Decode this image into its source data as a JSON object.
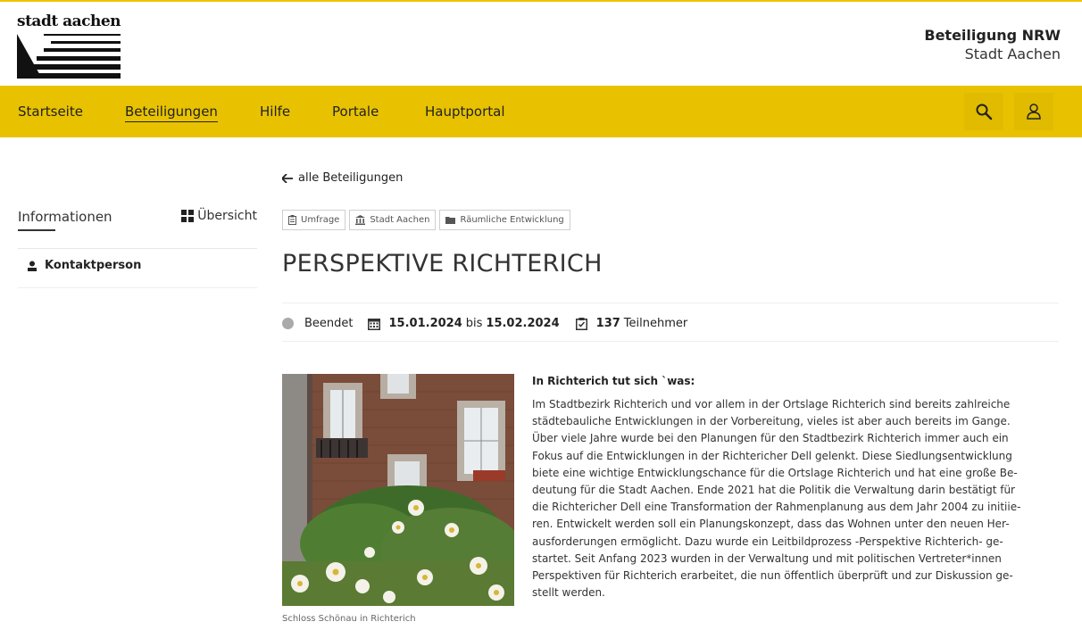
{
  "header": {
    "logo_text": "stadt aachen",
    "brand_title": "Beteiligung NRW",
    "brand_subtitle": "Stadt Aachen"
  },
  "nav": {
    "items": [
      {
        "label": "Startseite",
        "active": false
      },
      {
        "label": "Beteiligungen",
        "active": true
      },
      {
        "label": "Hilfe",
        "active": false
      },
      {
        "label": "Portale",
        "active": false
      },
      {
        "label": "Hauptportal",
        "active": false
      }
    ],
    "search_icon": "search-icon",
    "user_icon": "user-icon"
  },
  "sidebar": {
    "title": "Informationen",
    "overview_label": "Übersicht",
    "items": [
      {
        "label": "Kontaktperson",
        "icon": "person-icon"
      }
    ]
  },
  "main": {
    "back_label": "alle Beteiligungen",
    "tags": [
      {
        "label": "Umfrage",
        "icon": "clipboard-icon"
      },
      {
        "label": "Stadt Aachen",
        "icon": "building-icon"
      },
      {
        "label": "Räumliche Entwicklung",
        "icon": "folder-icon"
      }
    ],
    "title": "PERSPEKTIVE RICHTERICH",
    "meta": {
      "status": "Beendet",
      "start_date": "15.01.2024",
      "between": "bis",
      "end_date": "15.02.2024",
      "participants_count": "137",
      "participants_label": "Teilnehmer"
    },
    "image_caption": "Schloss Schönau in Richterich",
    "article_heading": "In Richterich tut sich `was:",
    "article_lines": [
      "Im Stadtbezirk Richterich und vor allem in der Ortslage Richterich sind bereits zahlreiche",
      "städtebauliche Entwicklungen in der Vorbereitung, vieles ist aber auch bereits im Gange.",
      "Über viele Jahre wurde bei den Planungen für den Stadtbezirk Richterich immer auch ein",
      "Fokus auf die Entwicklungen in der Richtericher Dell gelenkt. Diese Siedlungsentwicklung",
      "biete eine wichtige Entwicklungschance für die Ortslage Richterich und hat eine große Be-",
      "deutung für die Stadt Aachen. Ende 2021 hat die Politik die Verwaltung darin bestätigt für",
      "die Richtericher Dell eine Transformation der Rahmenplanung aus dem Jahr 2004 zu initiie-",
      "ren. Entwickelt werden soll ein Planungskonzept, dass das Wohnen unter den neuen Her-",
      "ausforderungen ermöglicht. Dazu wurde ein Leitbildprozess -Perspektive Richterich- ge-",
      "startet. Seit Anfang 2023 wurden in der Verwaltung und mit politischen Vertreter*innen",
      "Perspektiven für Richterich erarbeitet, die nun öffentlich überprüft und zur Diskussion ge-",
      "stellt werden."
    ]
  },
  "colors": {
    "accent": "#e8c200",
    "text": "#333333",
    "status_ended": "#aaaaaa"
  }
}
